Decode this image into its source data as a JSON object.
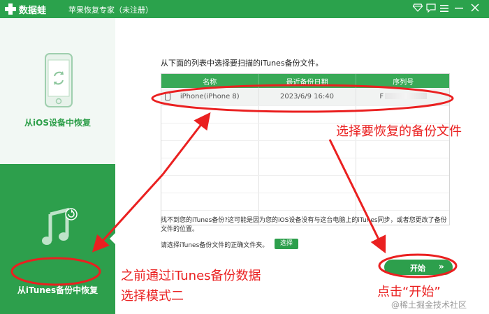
{
  "titlebar": {
    "app_name": "数据蛙",
    "window_title": "苹果恢复专家（未注册）",
    "icons": [
      "diamond-icon",
      "chat-icon",
      "menu-icon",
      "minimize-icon",
      "close-icon"
    ],
    "brand_color": "#2ba24c"
  },
  "sidebar": {
    "items": [
      {
        "label": "从iOS设备中恢复",
        "icon": "phone-recover-icon",
        "active": false
      },
      {
        "label": "从iTunes备份中恢复",
        "icon": "music-note-icon",
        "active": true
      }
    ]
  },
  "main": {
    "prompt": "从下面的列表中选择要扫描的iTunes备份文件。",
    "table": {
      "columns": [
        "名称",
        "最近备份日期",
        "序列号"
      ],
      "rows": [
        {
          "name": "iPhone(iPhone 8)",
          "date": "2023/6/9 16:40",
          "serial": "F"
        }
      ]
    },
    "note": "找不到您的iTunes备份?这可能是因为您的iOS设备没有与这台电脑上的iTunes同步，或者您更改了备份文件的位置。",
    "choose_label": "请选择iTunes备份文件的正确文件夹。",
    "choose_button": "选择",
    "start_button": "开始",
    "start_chevron": "»"
  },
  "annotations": {
    "select_file": "选择要恢复的备份文件",
    "mode_line1": "之前通过iTunes备份数据",
    "mode_line2": "选择模式二",
    "click_start": "点击“开始”",
    "color": "#ea2020"
  },
  "watermark": "@稀土掘金技术社区"
}
